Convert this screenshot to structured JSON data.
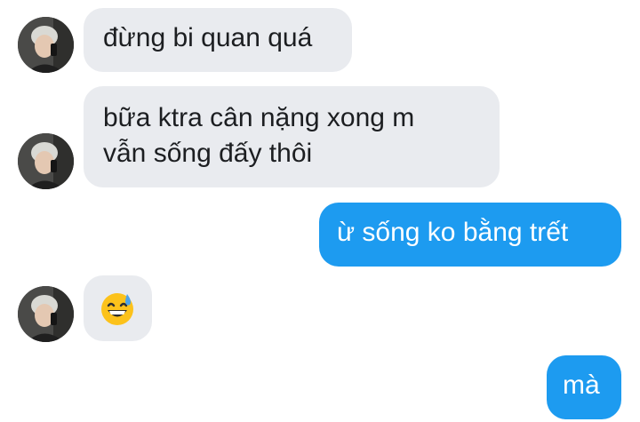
{
  "messages": [
    {
      "direction": "incoming",
      "text": "đừng bi quan quá"
    },
    {
      "direction": "incoming",
      "lines": [
        "bữa ktra cân nặng xong m",
        "vẫn sống đấy thôi"
      ]
    },
    {
      "direction": "outgoing",
      "text": "ừ sống ko bằng trết"
    },
    {
      "direction": "incoming",
      "emoji": "grinning-face-with-sweat"
    },
    {
      "direction": "outgoing",
      "text": "mà"
    }
  ],
  "colors": {
    "incoming_bubble": "#e9ebef",
    "outgoing_bubble": "#1d9bf0",
    "incoming_text": "#1c1e21",
    "outgoing_text": "#ffffff"
  }
}
